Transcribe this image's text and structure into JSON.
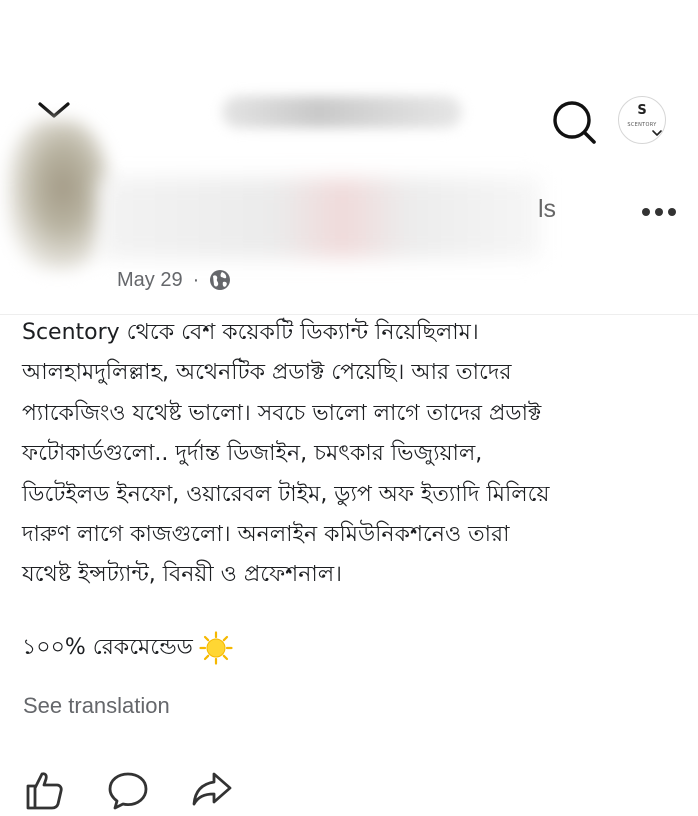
{
  "header": {
    "back_icon": "chevron-down-icon",
    "search_icon": "search-icon",
    "page_avatar": {
      "mark": "S",
      "small_text": "SCENTORY"
    }
  },
  "post": {
    "author_name_suffix": "ls",
    "date": "May 29",
    "separator": "·",
    "privacy_icon": "globe-icon",
    "body_lines": [
      "Scentory থেকে বেশ কয়েকটি ডিক্যান্ট নিয়েছিলাম।",
      "আলহামদুলিল্লাহ, অথেনটিক প্রডাক্ট পেয়েছি। আর তাদের",
      "প্যাকেজিংও যথেষ্ট ভালো। সবচে ভালো লাগে তাদের প্রডাক্ট",
      "ফটোকার্ডগুলো.. দুর্দান্ত ডিজাইন, চমৎকার ভিজ্যুয়াল,",
      "ডিটেইলড ইনফো, ওয়ারেবল টাইম, ড্যুপ অফ ইত্যাদি মিলিয়ে",
      "দারুণ লাগে কাজগুলো। অনলাইন কমিউনিকশনেও তারা",
      "যথেষ্ট ইন্সট্যান্ট, বিনয়ী ও প্রফেশনাল।"
    ],
    "recommendation": "১০০% রেকমেন্ডেড",
    "recommendation_emoji": "sun-emoji",
    "see_translation": "See translation"
  },
  "actions": {
    "like_icon": "like-icon",
    "comment_icon": "comment-icon",
    "share_icon": "share-icon"
  },
  "colors": {
    "text": "#1c1e21",
    "secondary": "#65676b",
    "sun": "#f5c518"
  }
}
